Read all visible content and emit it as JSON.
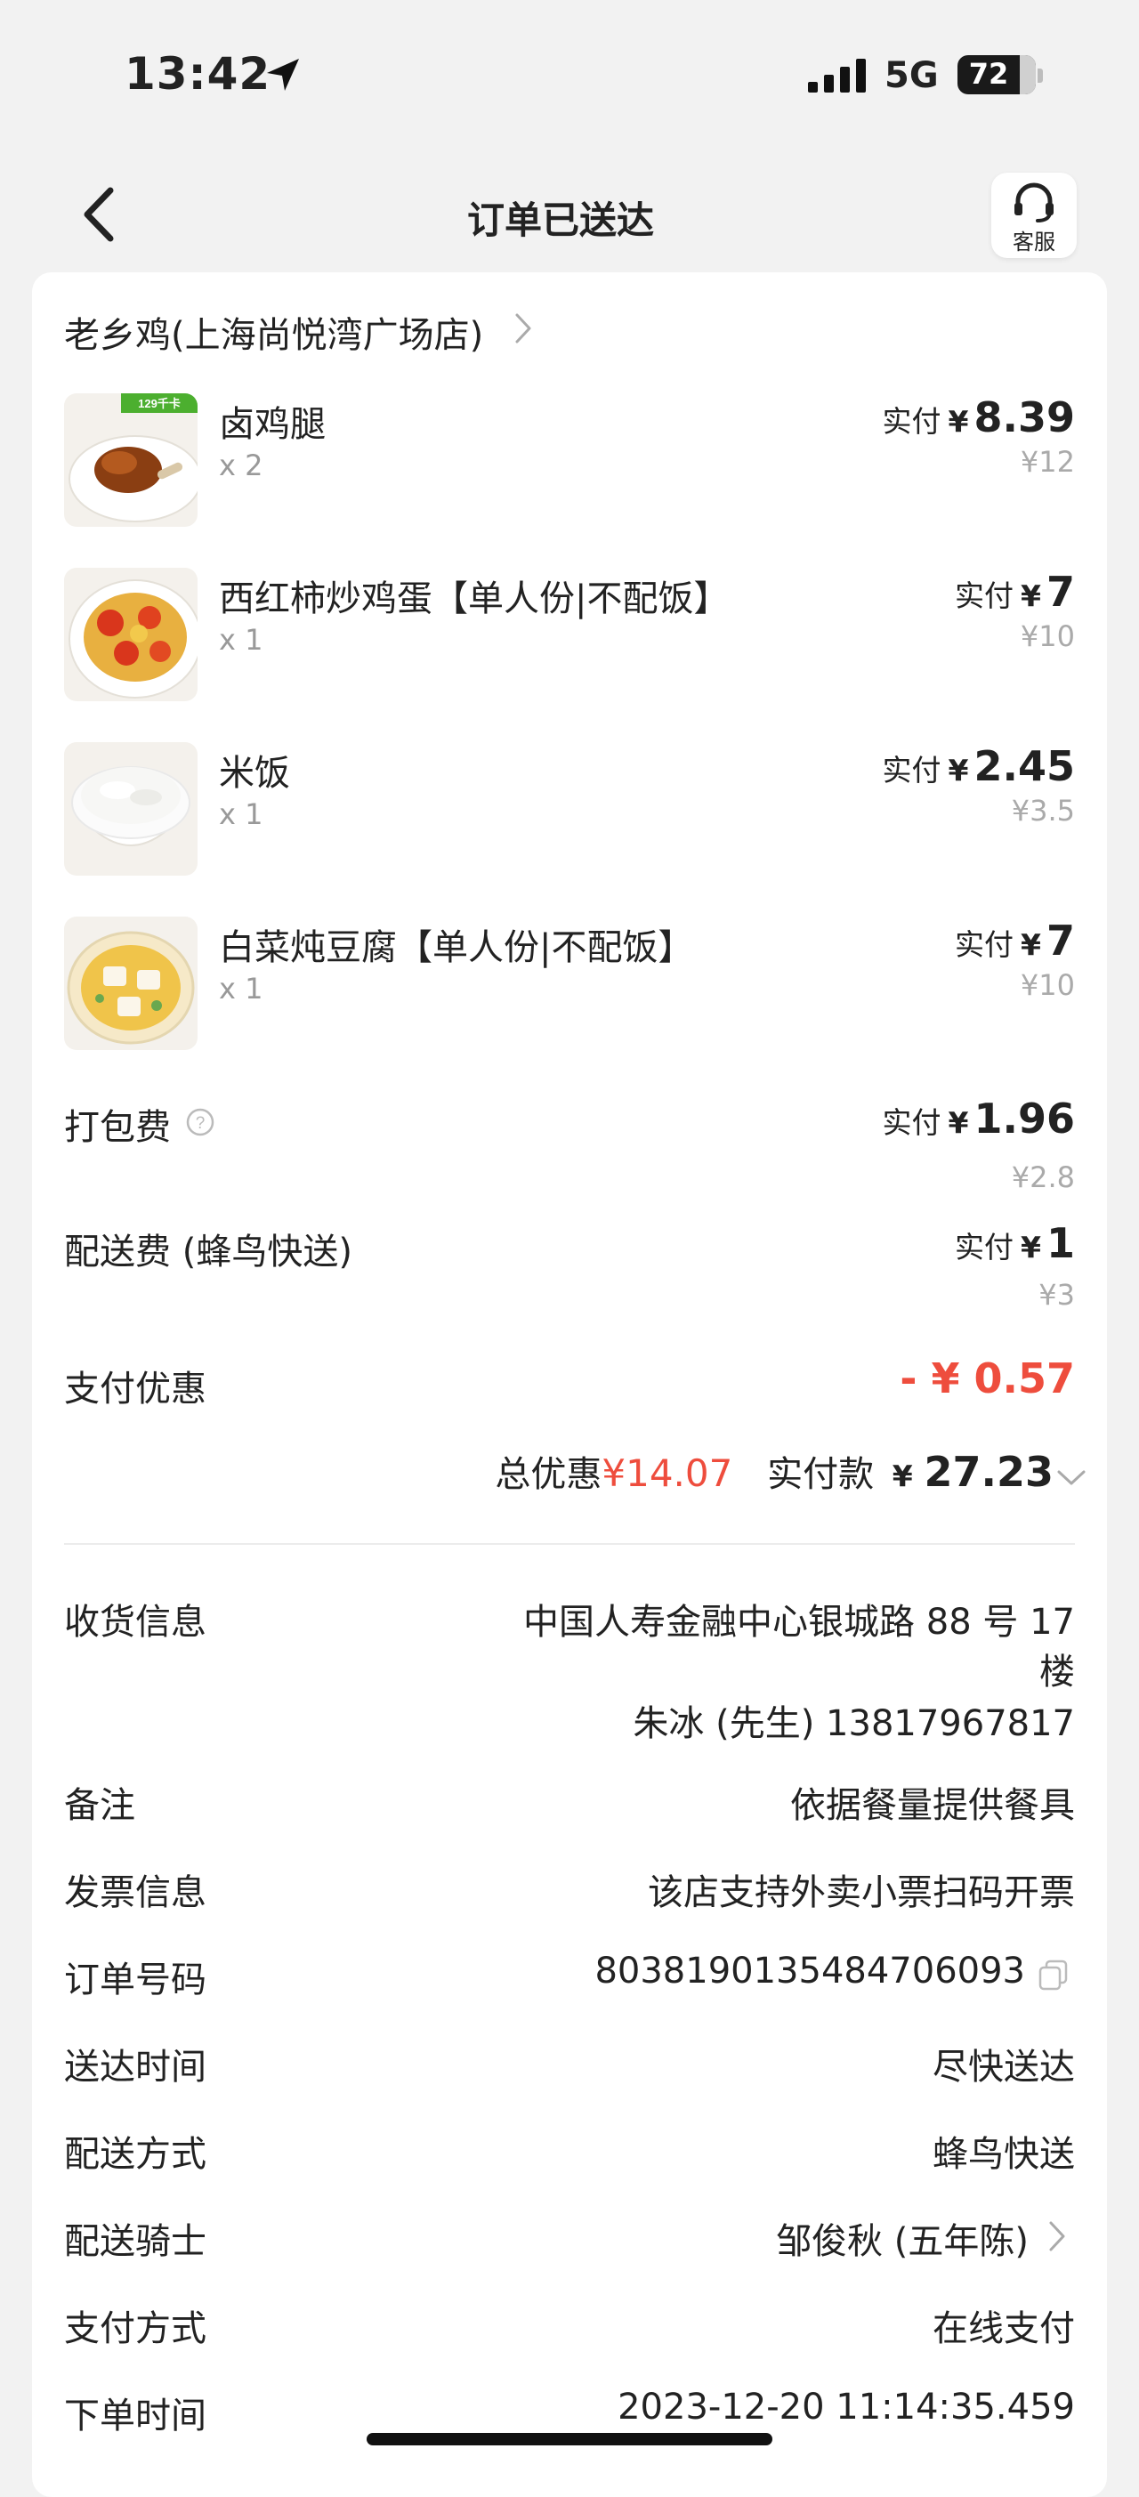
{
  "status_bar": {
    "time": "13:42",
    "network": "5G",
    "battery": "72"
  },
  "nav": {
    "title": "订单已送达",
    "service_label": "客服"
  },
  "store": {
    "name": "老乡鸡(上海尚悦湾广场店)"
  },
  "items": [
    {
      "name": "卤鸡腿",
      "qty": "x 2",
      "pay_label": "实付",
      "currency": "¥",
      "pay": "8.39",
      "original": "¥12",
      "badge": "129千卡"
    },
    {
      "name": "西红柿炒鸡蛋【单人份|不配饭】",
      "qty": "x 1",
      "pay_label": "实付",
      "currency": "¥",
      "pay": "7",
      "original": "¥10"
    },
    {
      "name": "米饭",
      "qty": "x 1",
      "pay_label": "实付",
      "currency": "¥",
      "pay": "2.45",
      "original": "¥3.5"
    },
    {
      "name": "白菜炖豆腐【单人份|不配饭】",
      "qty": "x 1",
      "pay_label": "实付",
      "currency": "¥",
      "pay": "7",
      "original": "¥10"
    }
  ],
  "fees": {
    "packing": {
      "name": "打包费",
      "pay_label": "实付",
      "currency": "¥",
      "pay": "1.96",
      "original": "¥2.8"
    },
    "delivery": {
      "name": "配送费 (蜂鸟快送)",
      "pay_label": "实付",
      "currency": "¥",
      "pay": "1",
      "original": "¥3"
    },
    "discount": {
      "name": "支付优惠",
      "value": "- ¥ 0.57"
    }
  },
  "totals": {
    "discount_label": "总优惠",
    "discount_value": "¥14.07",
    "paid_label": "实付款",
    "currency": "¥",
    "paid_value": "27.23"
  },
  "info": {
    "address_label": "收货信息",
    "address_line1": "中国人寿金融中心银城路 88 号 17",
    "address_line2": "楼",
    "contact": "朱冰 (先生) 13817967817",
    "remark_label": "备注",
    "remark": "依据餐量提供餐具",
    "invoice_label": "发票信息",
    "invoice": "该店支持外卖小票扫码开票",
    "order_no_label": "订单号码",
    "order_no": "8038190135484706093",
    "delivery_time_label": "送达时间",
    "delivery_time": "尽快送达",
    "delivery_method_label": "配送方式",
    "delivery_method": "蜂鸟快送",
    "rider_label": "配送骑士",
    "rider": "邹俊秋 (五年陈)",
    "payment_label": "支付方式",
    "payment": "在线支付",
    "order_time_label": "下单时间",
    "order_time": "2023-12-20 11:14:35.459"
  }
}
